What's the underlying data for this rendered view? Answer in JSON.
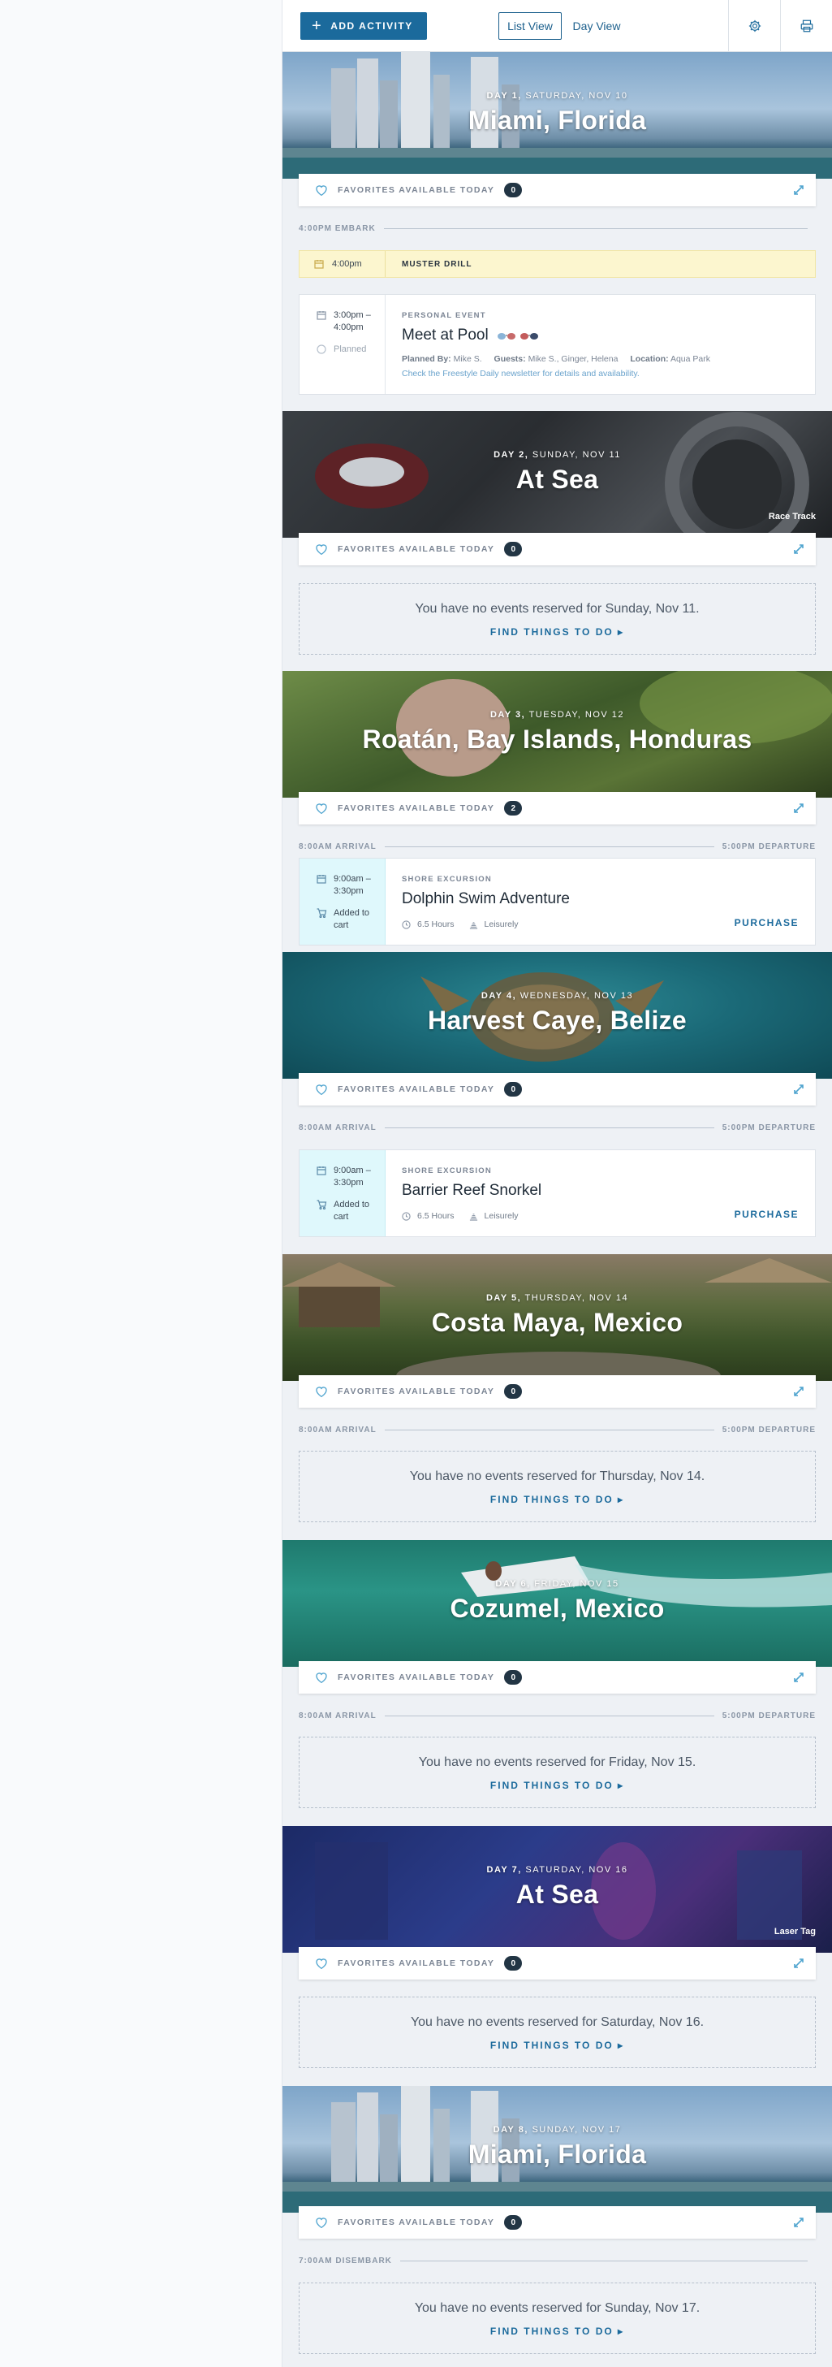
{
  "toolbar": {
    "add_activity": "ADD ACTIVITY",
    "list_view": "List View",
    "day_view": "Day View",
    "settings_icon": "gear-icon",
    "print_icon": "printer-icon"
  },
  "favorites_label": "FAVORITES AVAILABLE TODAY",
  "find_label": "FIND THINGS TO DO",
  "days": [
    {
      "day_label": "DAY 1,",
      "date": "SATURDAY, NOV 10",
      "port": "Miami, Florida",
      "fav_count": "0",
      "timeline_left": "4:00PM EMBARK",
      "timeline_right": ""
    },
    {
      "day_label": "DAY 2,",
      "date": "SUNDAY, NOV 11",
      "port": "At Sea",
      "photo_label": "Race Track",
      "fav_count": "0",
      "empty_msg": "You have no events reserved for Sunday, Nov 11."
    },
    {
      "day_label": "DAY 3,",
      "date": "TUESDAY, NOV 12",
      "port": "Roatán, Bay Islands, Honduras",
      "fav_count": "2",
      "timeline_left": "8:00AM ARRIVAL",
      "timeline_right": "5:00PM DEPARTURE"
    },
    {
      "day_label": "DAY 4,",
      "date": "WEDNESDAY, NOV 13",
      "port": "Harvest Caye, Belize",
      "fav_count": "0",
      "timeline_left": "8:00AM ARRIVAL",
      "timeline_right": "5:00PM DEPARTURE"
    },
    {
      "day_label": "DAY 5,",
      "date": "THURSDAY, NOV 14",
      "port": "Costa Maya, Mexico",
      "fav_count": "0",
      "timeline_left": "8:00AM ARRIVAL",
      "timeline_right": "5:00PM DEPARTURE",
      "empty_msg": "You have no events reserved for Thursday, Nov 14."
    },
    {
      "day_label": "DAY 6,",
      "date": "FRIDAY, NOV 15",
      "port": "Cozumel, Mexico",
      "fav_count": "0",
      "timeline_left": "8:00AM ARRIVAL",
      "timeline_right": "5:00PM DEPARTURE",
      "empty_msg": "You have no events reserved for Friday, Nov 15."
    },
    {
      "day_label": "DAY 7,",
      "date": "SATURDAY, NOV 16",
      "port": "At Sea",
      "photo_label": "Laser Tag",
      "fav_count": "0",
      "empty_msg": "You have no events reserved for Saturday, Nov 16."
    },
    {
      "day_label": "DAY 8,",
      "date": "SUNDAY, NOV 17",
      "port": "Miami, Florida",
      "fav_count": "0",
      "timeline_left": "7:00AM DISEMBARK",
      "timeline_right": "",
      "empty_msg": "You have no events reserved for Sunday, Nov 17."
    }
  ],
  "muster": {
    "time": "4:00pm",
    "title": "MUSTER DRILL"
  },
  "pool_event": {
    "time": "3:00pm – 4:00pm",
    "status": "Planned",
    "kind": "PERSONAL EVENT",
    "title": "Meet at Pool",
    "planned_by_label": "Planned By:",
    "planned_by": "Mike S.",
    "guests_label": "Guests:",
    "guests": "Mike S., Ginger, Helena",
    "location_label": "Location:",
    "location": "Aqua Park",
    "note": "Check the Freestyle Daily newsletter for details and availability."
  },
  "excursions": [
    {
      "time": "9:00am – 3:30pm",
      "cart": "Added to cart",
      "kind": "SHORE EXCURSION",
      "title": "Dolphin Swim Adventure",
      "duration": "6.5 Hours",
      "activity": "Leisurely",
      "action": "PURCHASE"
    },
    {
      "time": "9:00am – 3:30pm",
      "cart": "Added to cart",
      "kind": "SHORE EXCURSION",
      "title": "Barrier Reef Snorkel",
      "duration": "6.5 Hours",
      "activity": "Leisurely",
      "action": "PURCHASE"
    }
  ],
  "colors": {
    "accent": "#1b6a9c",
    "muster_bg": "#fcf6cf",
    "cart_bg": "#dff8fc",
    "badge": "#223544"
  }
}
